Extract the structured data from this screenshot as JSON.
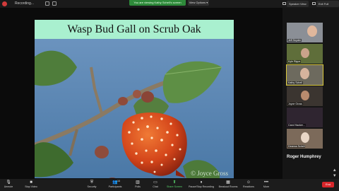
{
  "recording": {
    "label": "Recording..."
  },
  "share_banner": {
    "text": "You are viewing Kathy Schell's screen"
  },
  "view_options": {
    "label": "View Options ▾"
  },
  "top_right": {
    "speaker_view": "Speaker View",
    "exit_full": "Exit Full Screen"
  },
  "slide": {
    "title": "Wasp Bud Gall on Scrub Oak",
    "credit": "© Joyce Gross"
  },
  "gallery": {
    "participants": [
      {
        "name": "Jeff Snyder"
      },
      {
        "name": "Kyle Rippe"
      },
      {
        "name": "Kathy Schell"
      },
      {
        "name": "Joyce Gross"
      },
      {
        "name": "Carol Hacker..."
      },
      {
        "name": "Deanna Schell"
      }
    ],
    "name_only": "Roger Humphrey"
  },
  "toolbar": {
    "unmute": "Unmute",
    "stop_video": "Stop Video",
    "security": "Security",
    "participants": "Participants",
    "participants_count": "16",
    "polls": "Polls",
    "chat": "Chat",
    "share_screen": "Share Screen",
    "pause_recording": "Pause/Stop Recording",
    "breakout_rooms": "Breakout Rooms",
    "reactions": "Reactions",
    "more": "More",
    "end": "End"
  },
  "colors": {
    "share_green": "#2e8a3a",
    "end_red": "#d7262b",
    "slide_title_bg": "#a9f0cf"
  }
}
